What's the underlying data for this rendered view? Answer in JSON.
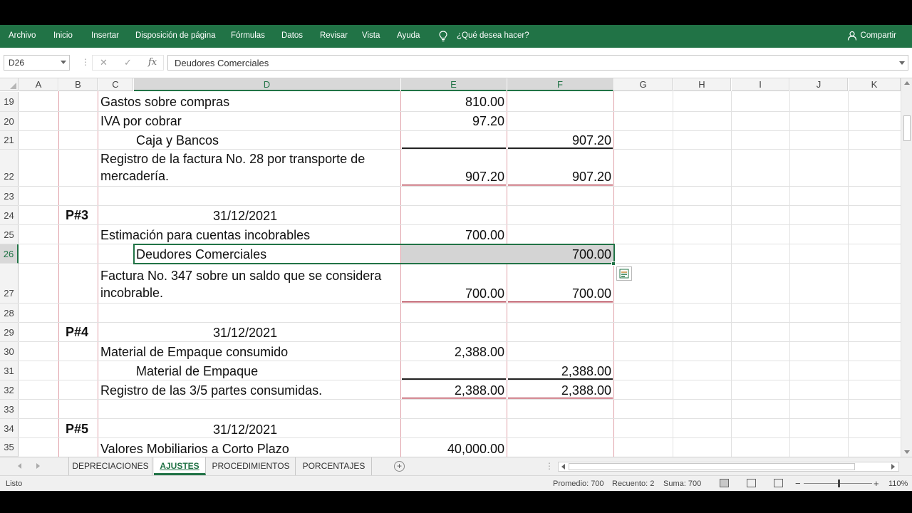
{
  "ribbon": {
    "tabs": [
      "Archivo",
      "Inicio",
      "Insertar",
      "Disposición de página",
      "Fórmulas",
      "Datos",
      "Revisar",
      "Vista",
      "Ayuda"
    ],
    "tell_me": "¿Qué desea hacer?",
    "share": "Compartir",
    "accent_color": "#217346"
  },
  "formula_bar": {
    "name_box": "D26",
    "cancel": "✕",
    "enter": "✓",
    "fx": "fx",
    "content": "Deudores Comerciales"
  },
  "columns": [
    "A",
    "B",
    "C",
    "D",
    "E",
    "F",
    "G",
    "H",
    "I",
    "J",
    "K"
  ],
  "rows": [
    "19",
    "20",
    "21",
    "22",
    "23",
    "24",
    "25",
    "26",
    "27",
    "28",
    "29",
    "30",
    "31",
    "32",
    "33",
    "34",
    "35"
  ],
  "cells": {
    "r19": {
      "text": "Gastos sobre compras",
      "e": "810.00"
    },
    "r20": {
      "text": "IVA por cobrar",
      "e": "97.20"
    },
    "r21": {
      "text": "Caja y Bancos",
      "f": "907.20"
    },
    "r22": {
      "text": "Registro de la factura No. 28 por transporte de mercadería.",
      "e": "907.20",
      "f": "907.20"
    },
    "r24": {
      "b": "P#3",
      "date": "31/12/2021"
    },
    "r25": {
      "text": "Estimación para cuentas incobrables",
      "e": "700.00"
    },
    "r26": {
      "text": "Deudores Comerciales",
      "f": "700.00"
    },
    "r27": {
      "text": "Factura No. 347 sobre un saldo que se considera incobrable.",
      "e": "700.00",
      "f": "700.00"
    },
    "r29": {
      "b": "P#4",
      "date": "31/12/2021"
    },
    "r30": {
      "text": "Material de Empaque consumido",
      "e": "2,388.00"
    },
    "r31": {
      "text": "Material de Empaque",
      "f": "2,388.00"
    },
    "r32": {
      "text": "Registro de las 3/5 partes consumidas.",
      "e": "2,388.00",
      "f": "2,388.00"
    },
    "r34": {
      "b": "P#5",
      "date": "31/12/2021"
    },
    "r35": {
      "text": "Valores Mobiliarios a Corto Plazo",
      "e": "40,000.00"
    }
  },
  "sheets": [
    "DEPRECIACIONES",
    "AJUSTES",
    "PROCEDIMIENTOS",
    "PORCENTAJES"
  ],
  "active_sheet": "AJUSTES",
  "status": {
    "mode": "Listo",
    "average": "Promedio: 700",
    "count": "Recuento: 2",
    "sum": "Suma: 700",
    "zoom": "110%",
    "zoom_minus": "−",
    "zoom_plus": "+"
  }
}
